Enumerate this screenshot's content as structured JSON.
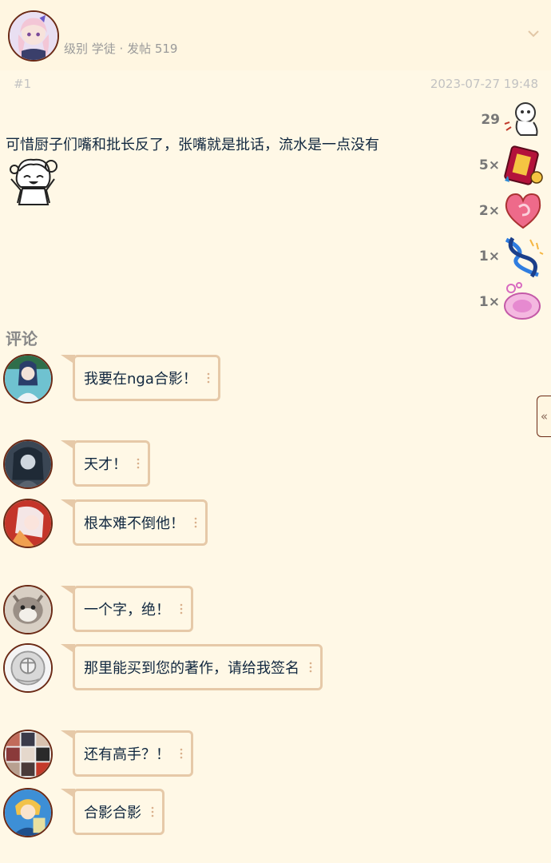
{
  "header": {
    "meta": "级别 学徒 · 发帖 519",
    "chevron_icon": "chevron-down-icon"
  },
  "post": {
    "floor": "#1",
    "date": "2023-07-27 19:48",
    "text": "可惜厨子们嘴和批长反了，张嘴就是批话，流水是一点没有",
    "emoji": "laughing-girl-sticker"
  },
  "reactions": [
    {
      "count": "29",
      "icon": "ghost-kneel-icon"
    },
    {
      "count": "5×",
      "icon": "red-book-icon"
    },
    {
      "count": "2×",
      "icon": "pink-heart-icon"
    },
    {
      "count": "1×",
      "icon": "dna-helix-icon"
    },
    {
      "count": "1×",
      "icon": "pink-gem-icon"
    }
  ],
  "comments_title": "评论",
  "side_tab": "«",
  "comments": [
    {
      "text": "我要在nga合影！"
    },
    {
      "text": "天才！"
    },
    {
      "text": "根本难不倒他！"
    },
    {
      "text": "一个字，绝！"
    },
    {
      "text": "那里能买到您的著作，请给我签名"
    },
    {
      "text": "还有高手？！"
    },
    {
      "text": "合影合影"
    }
  ],
  "colors": {
    "background": "#fff8e6",
    "bubble_border": "#e6c9a8",
    "avatar_border": "#6b2a16"
  }
}
